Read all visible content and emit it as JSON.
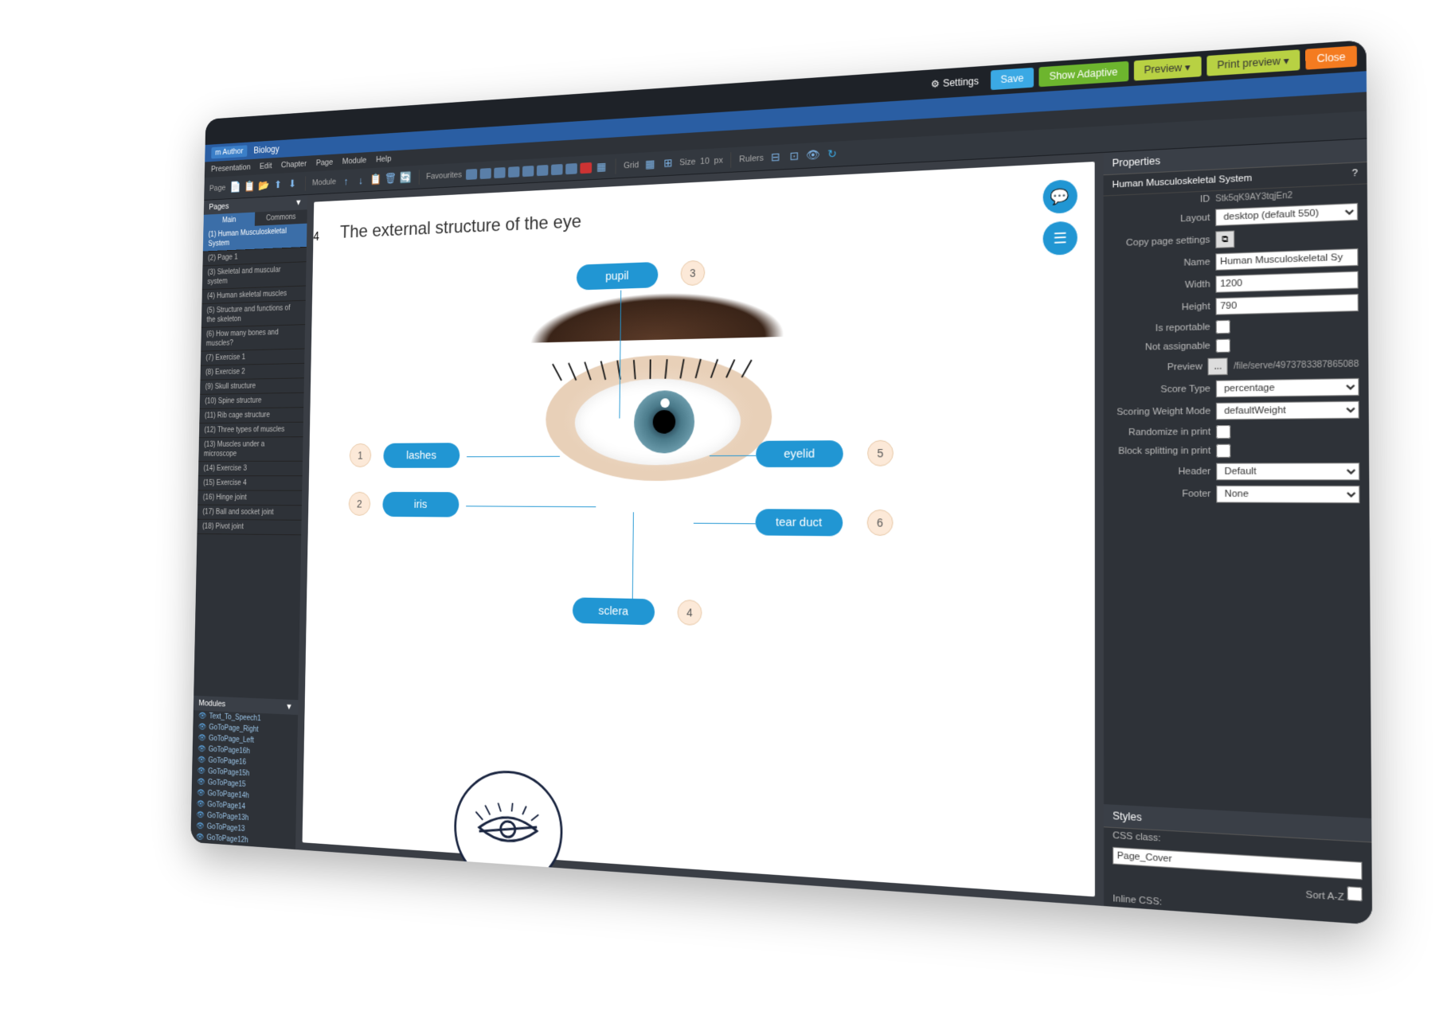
{
  "topbar": {
    "settings": "Settings",
    "save": "Save",
    "show_adaptive": "Show Adaptive",
    "preview": "Preview",
    "print_preview": "Print preview",
    "close": "Close"
  },
  "titlebar": {
    "logo": "m Author",
    "project": "Biology"
  },
  "menubar": [
    "Presentation",
    "Edit",
    "Chapter",
    "Page",
    "Module",
    "Help"
  ],
  "toolbar": {
    "page_label": "Page",
    "module_label": "Module",
    "favourites": "Favourites",
    "grid": "Grid",
    "size": "Size",
    "size_value": "10",
    "size_unit": "px",
    "rulers": "Rulers"
  },
  "pages_panel": {
    "title": "Pages",
    "tab_main": "Main",
    "tab_commons": "Commons",
    "items": [
      "(1) Human Musculoskeletal System",
      "(2) Page 1",
      "(3) Skeletal and muscular system",
      "(4) Human skeletal muscles",
      "(5) Structure and functions of the skeleton",
      "(6) How many bones and muscles?",
      "(7) Exercise 1",
      "(8) Exercise 2",
      "(9) Skull structure",
      "(10) Spine structure",
      "(11) Rib cage structure",
      "(12) Three types of muscles",
      "(13) Muscles under a microscope",
      "(14) Exercise 3",
      "(15) Exercise 4",
      "(16) Hinge joint",
      "(17) Ball and socket joint",
      "(18) Pivot joint"
    ]
  },
  "modules_panel": {
    "title": "Modules",
    "items": [
      "Text_To_Speech1",
      "GoToPage_Right",
      "GoToPage_Left",
      "GoToPage16h",
      "GoToPage16",
      "GoToPage15h",
      "GoToPage15",
      "GoToPage14h",
      "GoToPage14",
      "GoToPage13h",
      "GoToPage13",
      "GoToPage12h"
    ]
  },
  "canvas": {
    "title": "The external structure of the eye",
    "labels": {
      "pupil": "pupil",
      "lashes": "lashes",
      "iris": "iris",
      "eyelid": "eyelid",
      "tear_duct": "tear duct",
      "sclera": "sclera"
    },
    "numbers": {
      "n1": "1",
      "n2": "2",
      "n3": "3",
      "n4": "4",
      "n5": "5",
      "n6": "6"
    }
  },
  "properties": {
    "title": "Properties",
    "subtitle": "Human Musculoskeletal System",
    "id_label": "ID",
    "id_value": "Stk5qK9AY3tqjEn2",
    "layout_label": "Layout",
    "layout_value": "desktop (default 550)",
    "copy_label": "Copy page settings",
    "name_label": "Name",
    "name_value": "Human Musculoskeletal Sy",
    "width_label": "Width",
    "width_value": "1200",
    "height_label": "Height",
    "height_value": "790",
    "reportable_label": "Is reportable",
    "not_assignable_label": "Not assignable",
    "preview_label": "Preview",
    "preview_btn": "...",
    "preview_value": "/file/serve/4973783387865088",
    "score_type_label": "Score Type",
    "score_type_value": "percentage",
    "scoring_label": "Scoring Weight Mode",
    "scoring_value": "defaultWeight",
    "randomize_label": "Randomize in print",
    "block_split_label": "Block splitting in print",
    "header_label": "Header",
    "header_value": "Default",
    "footer_label": "Footer",
    "footer_value": "None"
  },
  "styles": {
    "title": "Styles",
    "css_class_label": "CSS class:",
    "css_class_value": "Page_Cover",
    "sort_label": "Sort A-Z",
    "inline_css_label": "Inline CSS:"
  }
}
